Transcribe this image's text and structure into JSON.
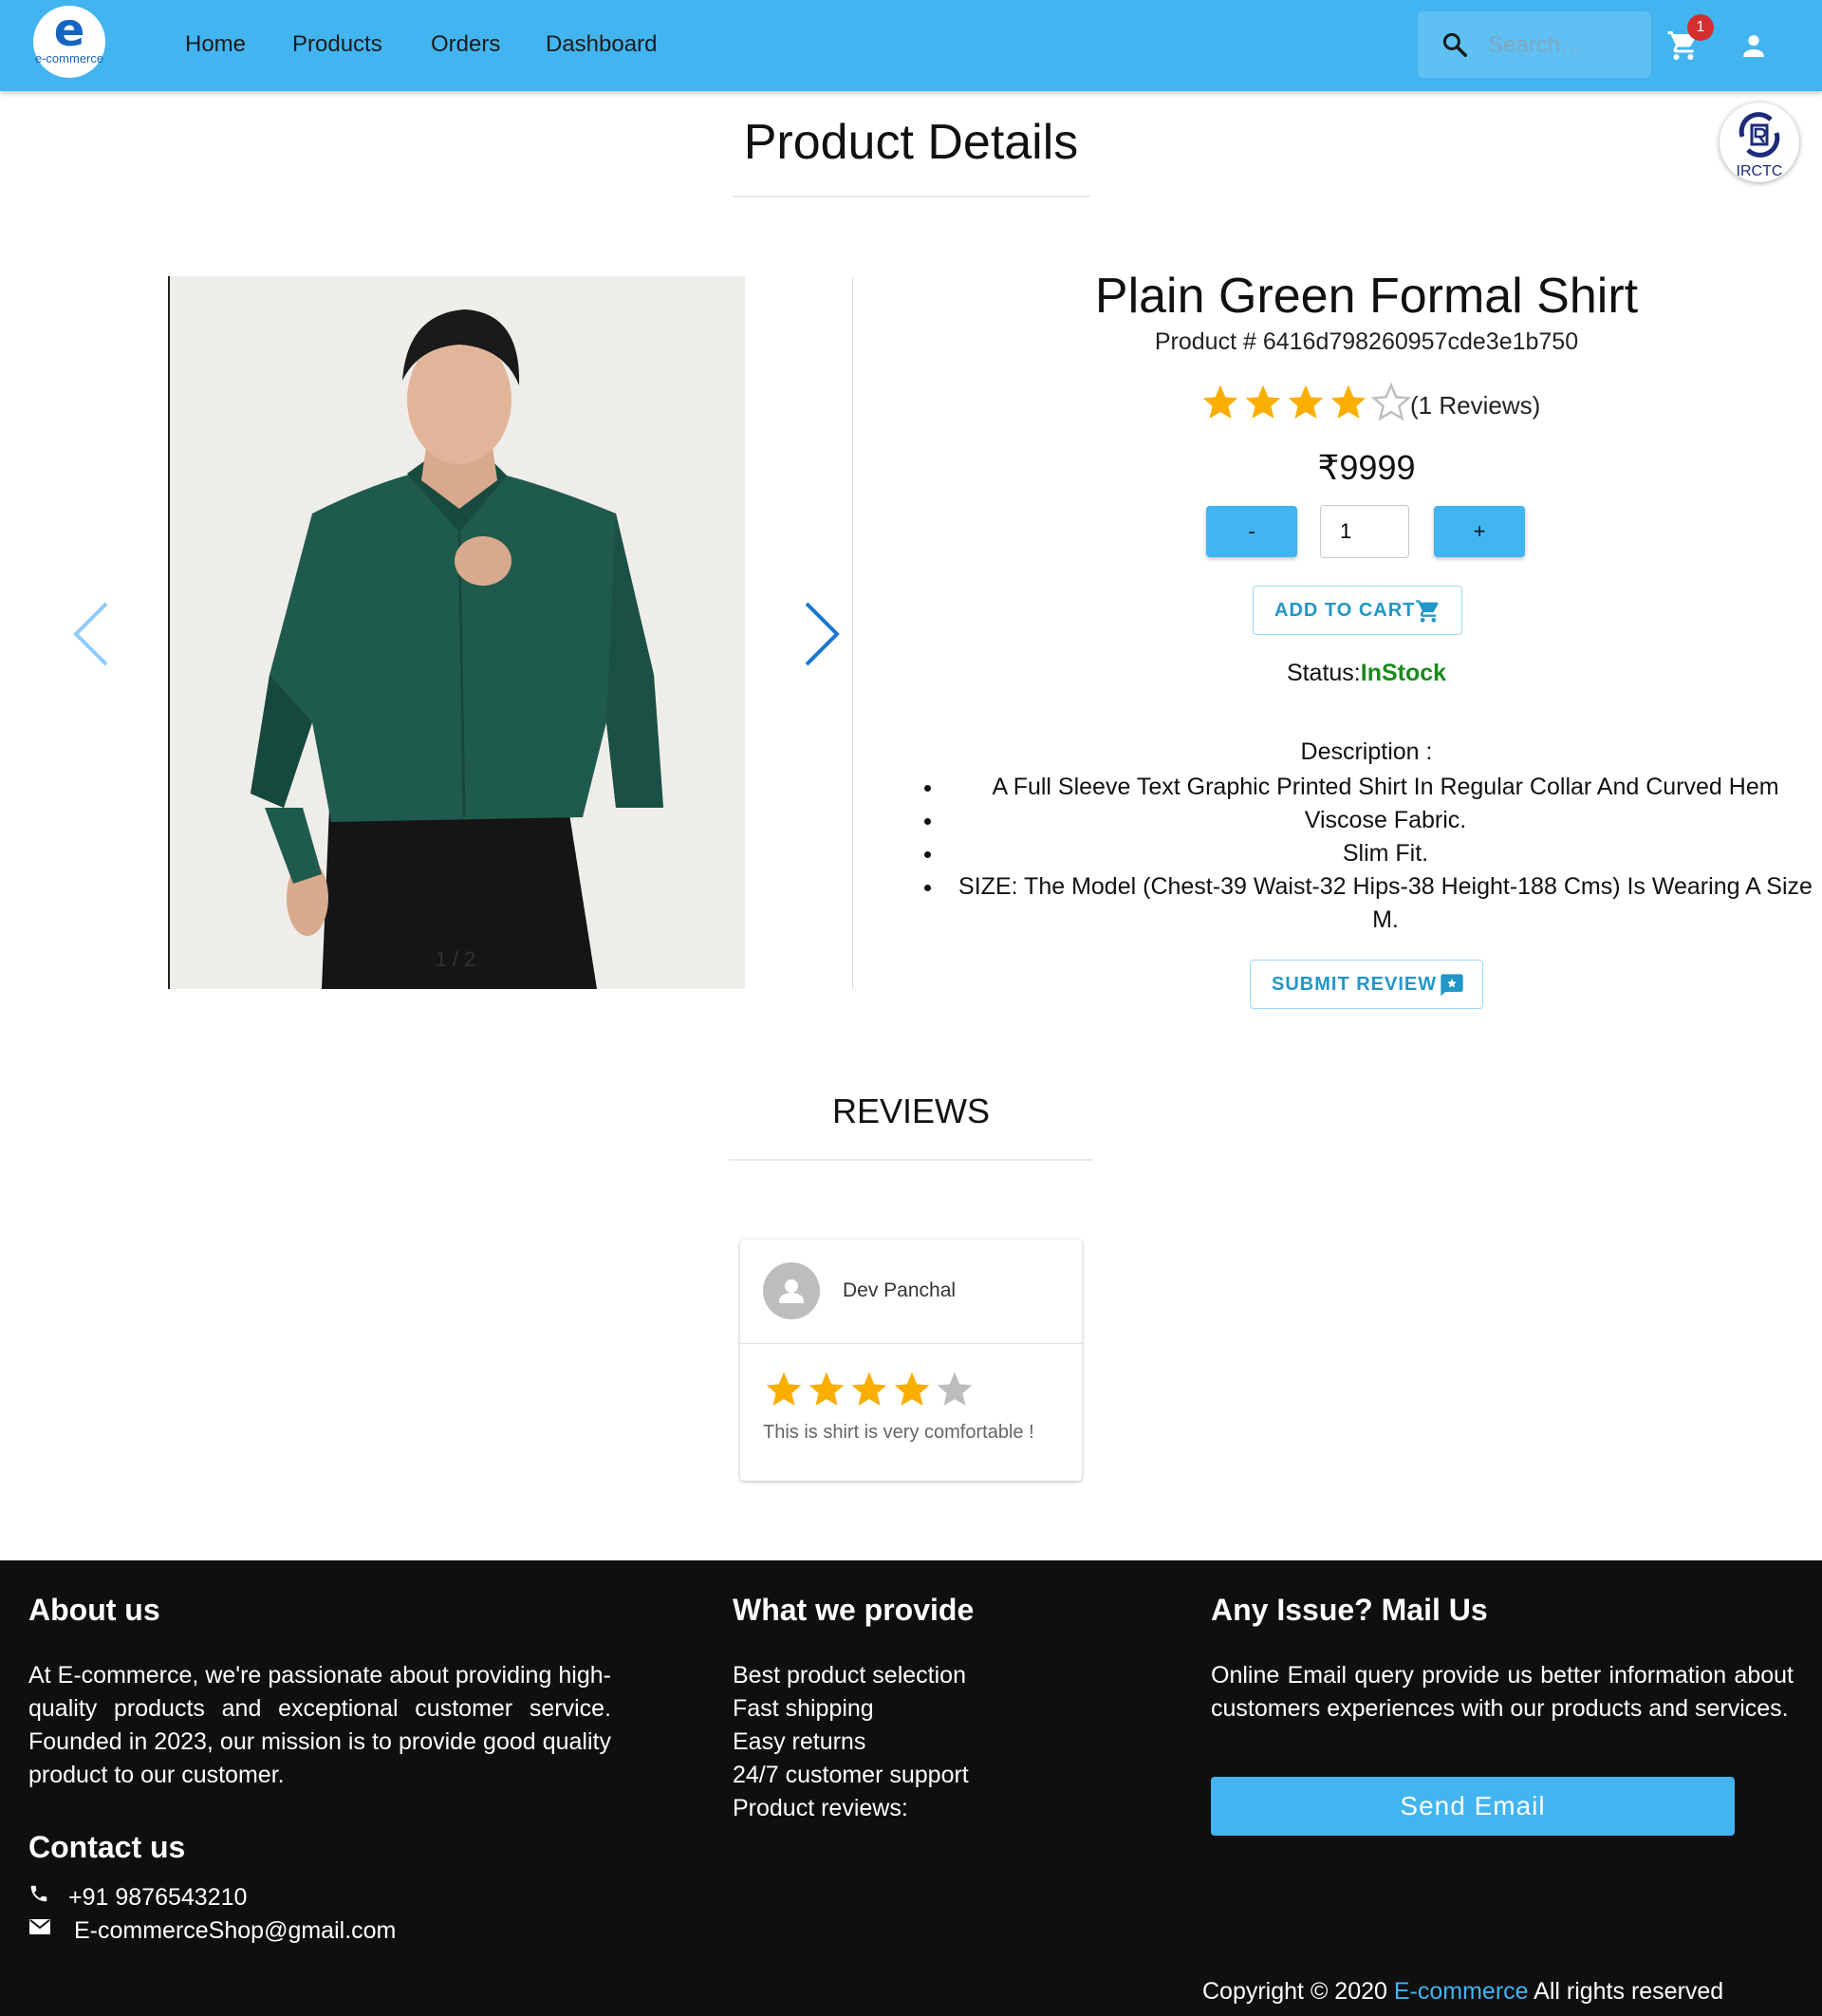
{
  "nav": {
    "logo_letter": "e",
    "logo_text": "e-commerce",
    "links": [
      "Home",
      "Products",
      "Orders",
      "Dashboard"
    ],
    "search_placeholder": "Search…",
    "cart_count": "1"
  },
  "floating_badge": {
    "label": "IRCTC"
  },
  "page_title": "Product Details",
  "product": {
    "name": "Plain Green Formal Shirt",
    "id_line": "Product # 6416d798260957cde3e1b750",
    "rating": 4,
    "rating_max": 5,
    "reviews_count_label": "(1 Reviews)",
    "price": "₹9999",
    "qty_minus": "-",
    "qty_plus": "+",
    "quantity": "1",
    "add_to_cart_label": "ADD TO CART",
    "status_label": "Status:",
    "status_value": "InStock",
    "description_title": "Description :",
    "description_points": [
      "A Full Sleeve Text Graphic Printed Shirt In Regular Collar And Curved Hem",
      "Viscose Fabric.",
      "Slim Fit.",
      "SIZE: The Model (Chest-39 Waist-32 Hips-38 Height-188 Cms) Is Wearing A Size M."
    ],
    "submit_review_label": "SUBMIT REVIEW",
    "image_counter": "1 / 2"
  },
  "reviews": {
    "title": "REVIEWS",
    "items": [
      {
        "name": "Dev Panchal",
        "rating": 4,
        "rating_max": 5,
        "comment": "This is shirt is very comfortable !"
      }
    ]
  },
  "footer": {
    "about_title": "About us",
    "about_text": "At E-commerce, we're passionate about providing high-quality products and exceptional customer service. Founded in 2023, our mission is to provide good quality product to our customer.",
    "contact_title": "Contact us",
    "phone": "+91 9876543210",
    "email": "E-commerceShop@gmail.com",
    "provide_title": "What we provide",
    "provide_items": [
      "Best product selection",
      "Fast shipping",
      "Easy returns",
      "24/7 customer support",
      "Product reviews:"
    ],
    "mail_title": "Any Issue? Mail Us",
    "mail_text": "Online Email query provide us better information about customers experiences with our products and services.",
    "send_button": "Send Email",
    "copyright_prefix": "Copyright © 2020",
    "copyright_brand": "E-commerce",
    "copyright_suffix": "All rights reserved"
  },
  "colors": {
    "navbar": "#42b4f0",
    "star": "#faaf00",
    "star_empty": "#bdbdbd",
    "in_stock": "#1b8a1b",
    "footer_bg": "#0f0f0f"
  }
}
